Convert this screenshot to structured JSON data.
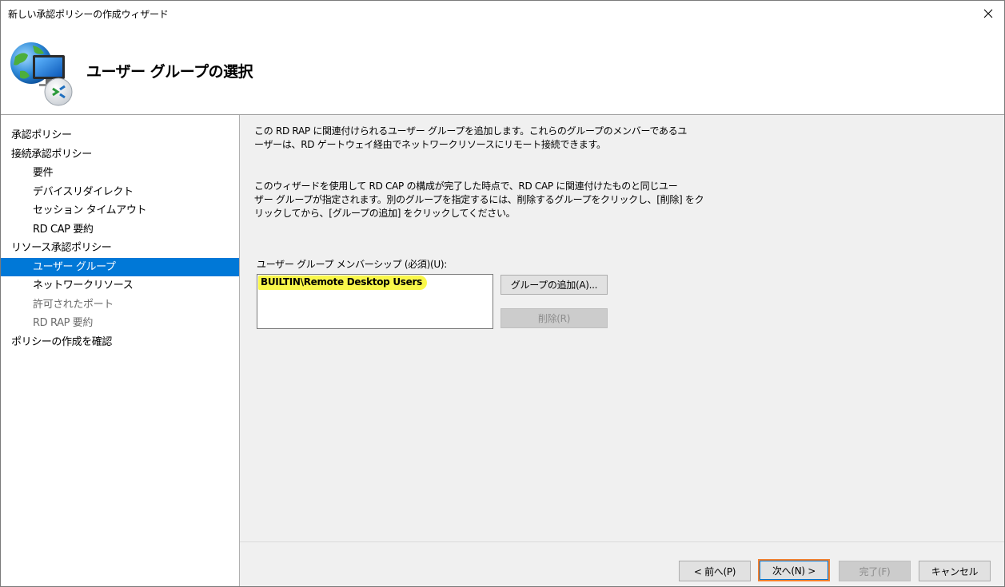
{
  "window": {
    "title": "新しい承認ポリシーの作成ウィザード",
    "close_icon": "close-icon"
  },
  "header": {
    "icon": "rd-gateway-globe-icon",
    "title": "ユーザー グループの選択"
  },
  "nav": {
    "items": [
      {
        "label": "承認ポリシー"
      },
      {
        "label": "接続承認ポリシー"
      },
      {
        "label": "要件"
      },
      {
        "label": "デバイスリダイレクト"
      },
      {
        "label": "セッション タイムアウト"
      },
      {
        "label": "RD CAP 要約"
      },
      {
        "label": "リソース承認ポリシー"
      },
      {
        "label": "ユーザー グループ"
      },
      {
        "label": "ネットワークリソース"
      },
      {
        "label": "許可されたポート"
      },
      {
        "label": "RD RAP 要約"
      },
      {
        "label": "ポリシーの作成を確認"
      }
    ]
  },
  "content": {
    "para1_line1": "この RD RAP に関連付けられるユーザー グループを追加します。これらのグループのメンバーであるユ",
    "para1_line2": "ーザーは、RD ゲートウェイ経由でネットワークリソースにリモート接続できます。",
    "para2_line1": "このウィザードを使用して RD CAP の構成が完了した時点で、RD CAP に関連付けたものと同じユー",
    "para2_line2": "ザー グループが指定されます。別のグループを指定するには、削除するグループをクリックし、[削除] をク",
    "para2_line3": "リックしてから、[グループの追加] をクリックしてください。",
    "list_label": "ユーザー グループ メンバーシップ (必須)(U):",
    "list_items": [
      "BUILTIN\\Remote Desktop Users"
    ],
    "add_button": "グループの追加(A)...",
    "remove_button": "削除(R)"
  },
  "footer": {
    "back": "< 前へ(P)",
    "next": "次へ(N) >",
    "finish": "完了(F)",
    "cancel": "キャンセル"
  },
  "colors": {
    "selection": "#0078d7",
    "highlight": "#f9f74a",
    "focus_outline": "#f08030",
    "panel_bg": "#f0f0f0"
  }
}
